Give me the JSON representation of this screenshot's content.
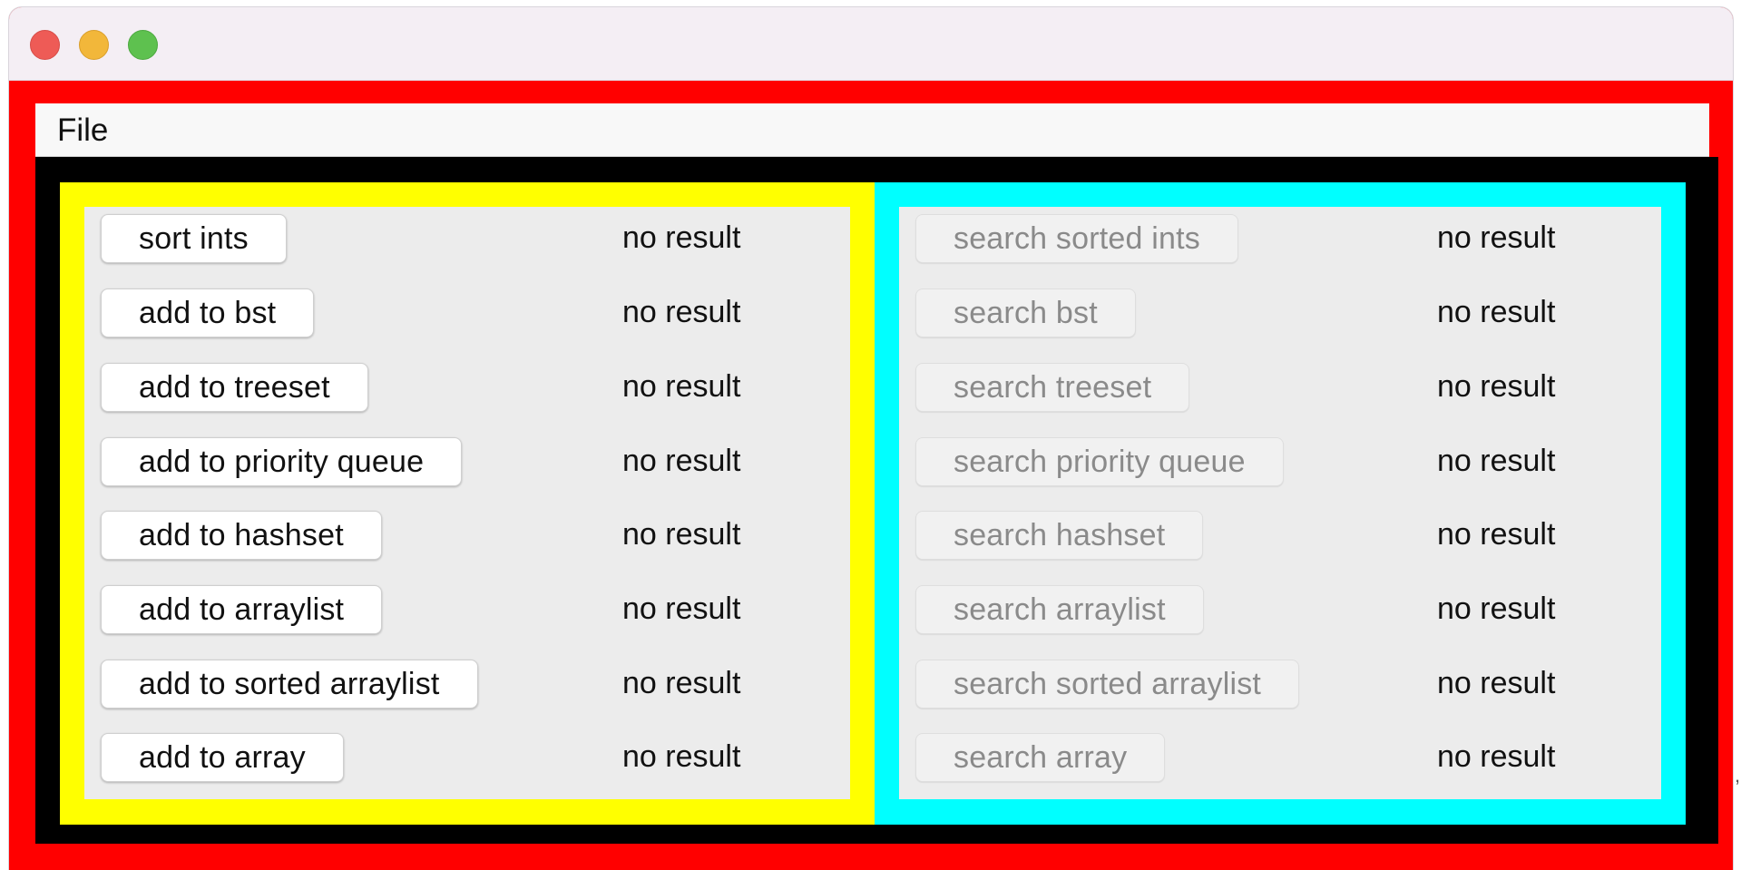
{
  "window": {
    "menu": {
      "file_label": "File"
    }
  },
  "left_panel": {
    "rows": [
      {
        "button": "sort ints",
        "result": "no result"
      },
      {
        "button": "add to bst",
        "result": "no result"
      },
      {
        "button": "add to treeset",
        "result": "no result"
      },
      {
        "button": "add to priority queue",
        "result": "no result"
      },
      {
        "button": "add to hashset",
        "result": "no result"
      },
      {
        "button": "add to arraylist",
        "result": "no result"
      },
      {
        "button": "add to sorted arraylist",
        "result": "no result"
      },
      {
        "button": "add to array",
        "result": "no result"
      }
    ]
  },
  "right_panel": {
    "rows": [
      {
        "button": "search sorted ints",
        "result": "no result"
      },
      {
        "button": "search bst",
        "result": "no result"
      },
      {
        "button": "search treeset",
        "result": "no result"
      },
      {
        "button": "search priority queue",
        "result": "no result"
      },
      {
        "button": "search hashset",
        "result": "no result"
      },
      {
        "button": "search arraylist",
        "result": "no result"
      },
      {
        "button": "search sorted arraylist",
        "result": "no result"
      },
      {
        "button": "search array",
        "result": "no result"
      }
    ]
  },
  "colors": {
    "window_background": "#ff0000",
    "content_frame": "#000000",
    "left_panel_border": "#ffff00",
    "right_panel_border": "#00ffff",
    "panel_background": "#ececec"
  },
  "icons": {
    "close": "close-window-icon",
    "minimize": "minimize-window-icon",
    "zoom": "zoom-window-icon"
  },
  "stray_mark": ","
}
